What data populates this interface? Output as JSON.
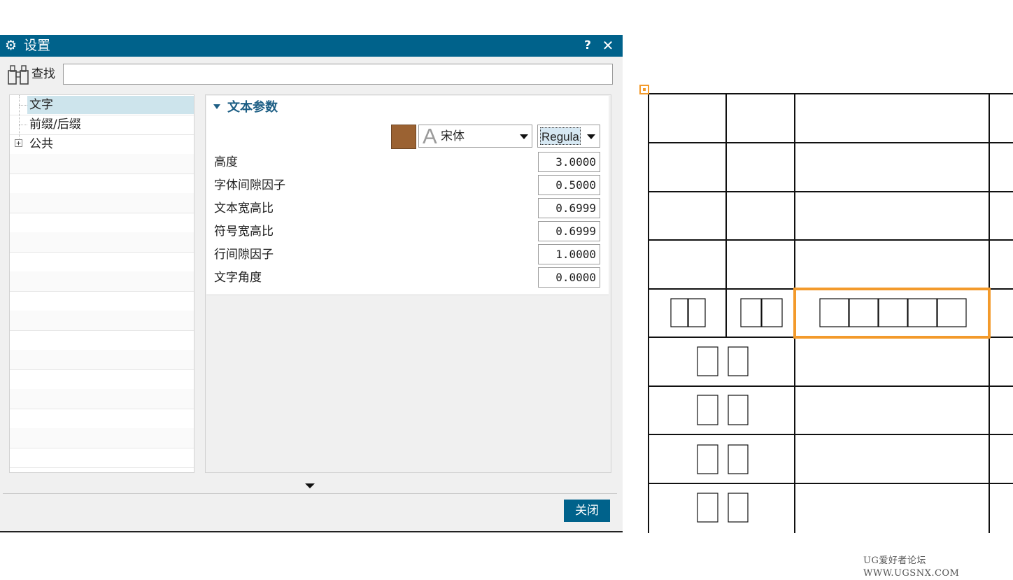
{
  "dialog": {
    "title": "设置",
    "help_glyph": "?",
    "close_glyph": "✕",
    "title_icon": "gear-icon"
  },
  "find": {
    "label": "查找",
    "value": "",
    "icon": "binoculars-icon"
  },
  "tree": {
    "items": [
      {
        "label": "文字",
        "selected": true
      },
      {
        "label": "前缀/后缀",
        "selected": false
      },
      {
        "label": "公共",
        "selected": false,
        "expandable": true
      }
    ],
    "expander_glyph": "+"
  },
  "text_params": {
    "title": "文本参数",
    "color": "#9b6232",
    "font_glyph": "A",
    "font_name": "宋体",
    "font_style": "Regular",
    "params": [
      {
        "label": "高度",
        "value": "3.0000"
      },
      {
        "label": "字体间隙因子",
        "value": "0.5000"
      },
      {
        "label": "文本宽高比",
        "value": "0.6999"
      },
      {
        "label": "符号宽高比",
        "value": "0.6999"
      },
      {
        "label": "行间隙因子",
        "value": "1.0000"
      },
      {
        "label": "文字角度",
        "value": "0.0000"
      }
    ]
  },
  "footer": {
    "close_label": "关闭"
  },
  "colors": {
    "title_bar": "#00628b",
    "highlight": "#f39a2b",
    "selection": "#cde4ec"
  },
  "watermark": "UG爱好者论坛 WWW.UGSNX.COM"
}
